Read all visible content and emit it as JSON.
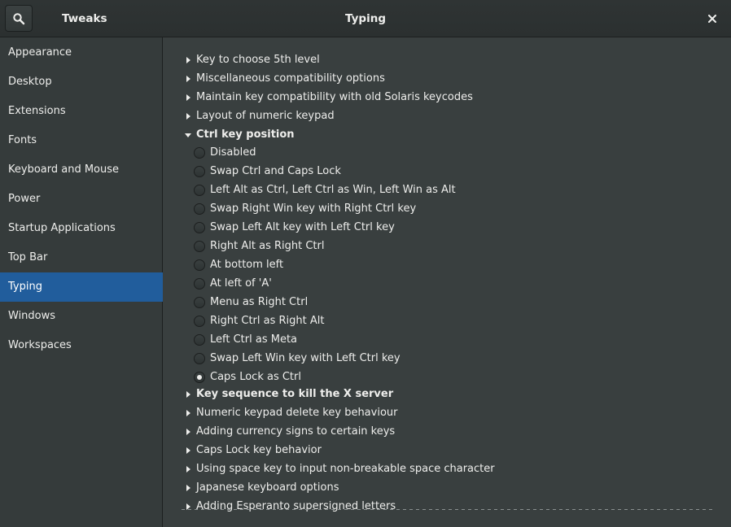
{
  "header": {
    "app_title": "Tweaks",
    "page_title": "Typing",
    "search_icon": "search-icon",
    "close_icon": "close-icon"
  },
  "sidebar": {
    "selected": "Typing",
    "items": [
      {
        "label": "Appearance"
      },
      {
        "label": "Desktop"
      },
      {
        "label": "Extensions"
      },
      {
        "label": "Fonts"
      },
      {
        "label": "Keyboard and Mouse"
      },
      {
        "label": "Power"
      },
      {
        "label": "Startup Applications"
      },
      {
        "label": "Top Bar"
      },
      {
        "label": "Typing"
      },
      {
        "label": "Windows"
      },
      {
        "label": "Workspaces"
      }
    ]
  },
  "content": {
    "options_before": [
      {
        "label": "Key to choose 5th level"
      },
      {
        "label": "Miscellaneous compatibility options"
      },
      {
        "label": "Maintain key compatibility with old Solaris keycodes"
      },
      {
        "label": "Layout of numeric keypad"
      }
    ],
    "expanded_group": {
      "label": "Ctrl key position",
      "options": [
        {
          "label": "Disabled",
          "checked": false
        },
        {
          "label": "Swap Ctrl and Caps Lock",
          "checked": false
        },
        {
          "label": "Left Alt as Ctrl, Left Ctrl as Win, Left Win as Alt",
          "checked": false
        },
        {
          "label": "Swap Right Win key with Right Ctrl key",
          "checked": false
        },
        {
          "label": "Swap Left Alt key with Left Ctrl key",
          "checked": false
        },
        {
          "label": "Right Alt as Right Ctrl",
          "checked": false
        },
        {
          "label": "At bottom left",
          "checked": false
        },
        {
          "label": "At left of 'A'",
          "checked": false
        },
        {
          "label": "Menu as Right Ctrl",
          "checked": false
        },
        {
          "label": "Right Ctrl as Right Alt",
          "checked": false
        },
        {
          "label": "Left Ctrl as Meta",
          "checked": false
        },
        {
          "label": "Swap Left Win key with Left Ctrl key",
          "checked": false
        },
        {
          "label": "Caps Lock as Ctrl",
          "checked": true
        }
      ]
    },
    "options_after": [
      {
        "label": "Key sequence to kill the X server",
        "bold": true
      },
      {
        "label": "Numeric keypad delete key behaviour",
        "bold": false
      },
      {
        "label": "Adding currency signs to certain keys",
        "bold": false
      },
      {
        "label": "Caps Lock key behavior",
        "bold": false
      },
      {
        "label": "Using space key to input non-breakable space character",
        "bold": false
      },
      {
        "label": "Japanese keyboard options",
        "bold": false
      },
      {
        "label": "Adding Esperanto supersigned letters",
        "bold": false
      }
    ]
  },
  "colors": {
    "background": "#393f3f",
    "sidebar_background": "#353b3b",
    "selection": "#215d9c",
    "text": "#eeeeec"
  }
}
